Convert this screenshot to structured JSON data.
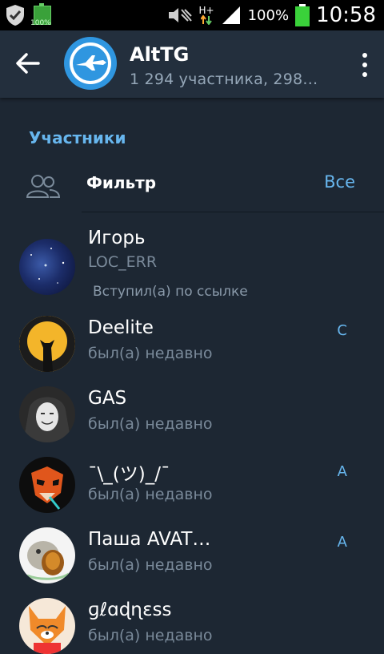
{
  "status_bar": {
    "mini_battery_text": "100%",
    "network_type": "H+",
    "battery_percent": "100%",
    "time": "10:58"
  },
  "header": {
    "title": "AltTG",
    "subtitle": "1 294 участника, 298…"
  },
  "section": {
    "title": "Участники"
  },
  "filter": {
    "label": "Фильтр",
    "value": "Все"
  },
  "members": [
    {
      "name": "Игорь",
      "status": "LOC_ERR",
      "note": "Вступил(а) по ссылке",
      "badge": ""
    },
    {
      "name": "Deelite",
      "status": "был(а) недавно",
      "badge": "C"
    },
    {
      "name": "GAS",
      "status": "был(а) недавно",
      "badge": ""
    },
    {
      "name": "¯\\_(ツ)_/¯",
      "status": "был(а) недавно",
      "badge": "A"
    },
    {
      "name": "Паша AVAT…",
      "status": "был(а) недавно",
      "badge": "A"
    },
    {
      "name": "ɡℓɑɖɳɛss",
      "status": "был(а) недавно",
      "badge": ""
    }
  ],
  "colors": {
    "background": "#1d2733",
    "header": "#232f3d",
    "accent": "#67b6ee"
  }
}
